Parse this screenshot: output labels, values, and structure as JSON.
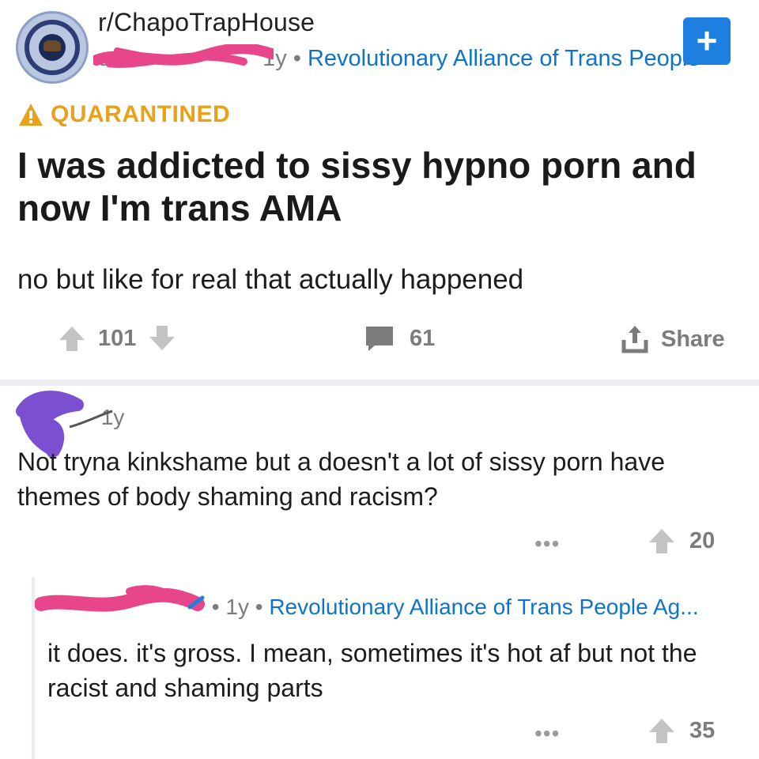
{
  "post": {
    "subreddit": "r/ChapoTrapHouse",
    "author_redacted": "u/",
    "age": "1y",
    "separator": "•",
    "flair": "Revolutionary Alliance of Trans People",
    "join_icon": "plus-icon",
    "quarantine_label": "QUARANTINED",
    "quarantine_icon": "warning-icon",
    "title": "I was addicted to sissy hypno porn and now I'm trans AMA",
    "body": "no but like for real that actually happened",
    "upvotes": "101",
    "comments": "61",
    "share_label": "Share"
  },
  "comment1": {
    "author_redacted": "W",
    "age": "1y",
    "text": "Not tryna kinkshame but a doesn't a lot of sissy porn have themes of body shaming and racism?",
    "more": "•••",
    "upvotes": "20"
  },
  "comment2": {
    "age": "1y",
    "separator": "•",
    "flair": "Revolutionary Alliance of Trans People Ag...",
    "text": "it does. it's gross. I mean, sometimes it's hot af but not the racist and shaming parts",
    "more": "•••",
    "upvotes": "35"
  },
  "colors": {
    "accent_blue": "#0f73c9",
    "quarantine": "#e7a11a",
    "join_button": "#1f7fe0",
    "redaction_pink": "#e8468a",
    "redaction_purple": "#7a4fd0"
  }
}
